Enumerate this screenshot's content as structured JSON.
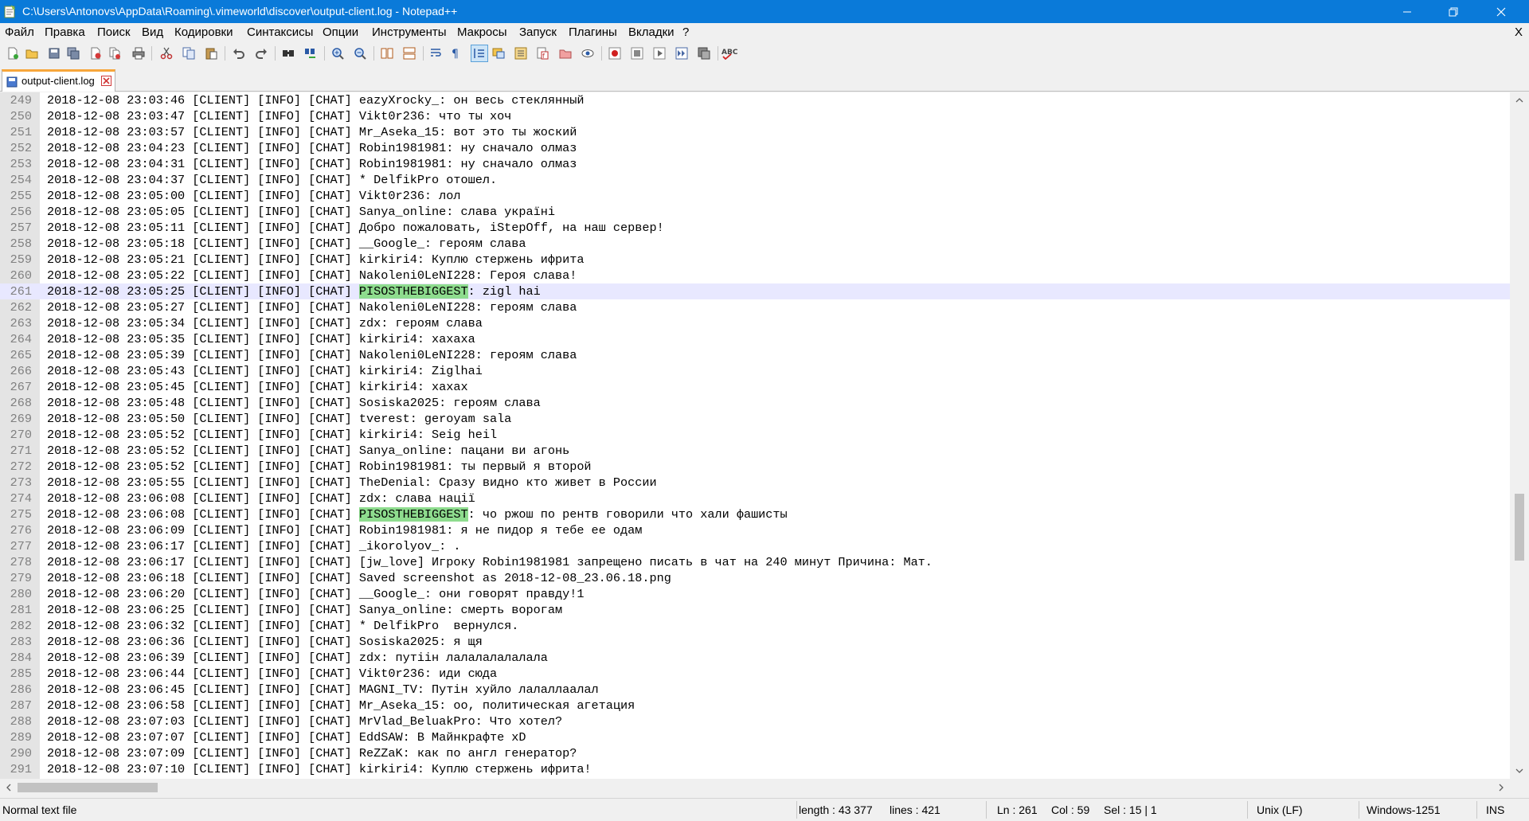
{
  "window": {
    "title": "C:\\Users\\Antonovs\\AppData\\Roaming\\.vimeworld\\discover\\output-client.log - Notepad++",
    "accent": "#0a7ad9"
  },
  "menu": [
    "Файл",
    "Правка",
    "Поиск",
    "Вид",
    "Кодировки",
    "Синтаксисы",
    "Опции",
    "Инструменты",
    "Макросы",
    "Запуск",
    "Плагины",
    "Вкладки",
    "?"
  ],
  "menu_close": "X",
  "toolbar_icons": [
    "new-file-icon",
    "open-file-icon",
    "save-icon",
    "save-all-icon",
    "close-icon",
    "close-all-icon",
    "print-icon",
    "cut-icon",
    "copy-icon",
    "paste-icon",
    "undo-icon",
    "redo-icon",
    "find-icon",
    "replace-icon",
    "zoom-in-icon",
    "zoom-out-icon",
    "sync-vertical-icon",
    "sync-horizontal-icon",
    "word-wrap-icon",
    "show-all-chars-icon",
    "indent-guide-icon",
    "document-map-icon",
    "function-list-icon",
    "folder-workspace-icon",
    "monitoring-icon",
    "record-macro-icon",
    "stop-macro-icon",
    "play-macro-icon",
    "run-macro-multiple-icon",
    "save-macro-icon",
    "spell-check-icon"
  ],
  "tab": {
    "label": "output-client.log"
  },
  "editor": {
    "current_line": 261,
    "highlight_word": "PISOSTHEBIGGEST",
    "lines": [
      {
        "n": "249",
        "t": "2018-12-08 23:03:46 [CLIENT] [INFO] [CHAT] eazyXrocky_: он весь стеклянный"
      },
      {
        "n": "250",
        "t": "2018-12-08 23:03:47 [CLIENT] [INFO] [CHAT] Vikt0r236: что ты хоч"
      },
      {
        "n": "251",
        "t": "2018-12-08 23:03:57 [CLIENT] [INFO] [CHAT] Mr_Aseka_15: вот это ты жоский"
      },
      {
        "n": "252",
        "t": "2018-12-08 23:04:23 [CLIENT] [INFO] [CHAT] Robin1981981: ну сначало олмаз"
      },
      {
        "n": "253",
        "t": "2018-12-08 23:04:31 [CLIENT] [INFO] [CHAT] Robin1981981: ну сначало олмаз"
      },
      {
        "n": "254",
        "t": "2018-12-08 23:04:37 [CLIENT] [INFO] [CHAT] * DelfikPro отошел."
      },
      {
        "n": "255",
        "t": "2018-12-08 23:05:00 [CLIENT] [INFO] [CHAT] Vikt0r236: лол"
      },
      {
        "n": "256",
        "t": "2018-12-08 23:05:05 [CLIENT] [INFO] [CHAT] Sanya_online: слава україні"
      },
      {
        "n": "257",
        "t": "2018-12-08 23:05:11 [CLIENT] [INFO] [CHAT] Добро пожаловать, iStepOff, на наш сервер!"
      },
      {
        "n": "258",
        "t": "2018-12-08 23:05:18 [CLIENT] [INFO] [CHAT] __Google_: героям слава"
      },
      {
        "n": "259",
        "t": "2018-12-08 23:05:21 [CLIENT] [INFO] [CHAT] kirkiri4: Куплю стержень ифрита"
      },
      {
        "n": "260",
        "t": "2018-12-08 23:05:22 [CLIENT] [INFO] [CHAT] Nakoleni0LeNI228: Героя слава!"
      },
      {
        "n": "261",
        "t": "2018-12-08 23:05:25 [CLIENT] [INFO] [CHAT] PISOSTHEBIGGEST: zigl hai"
      },
      {
        "n": "262",
        "t": "2018-12-08 23:05:27 [CLIENT] [INFO] [CHAT] Nakoleni0LeNI228: героям слава"
      },
      {
        "n": "263",
        "t": "2018-12-08 23:05:34 [CLIENT] [INFO] [CHAT] zdx: героям слава"
      },
      {
        "n": "264",
        "t": "2018-12-08 23:05:35 [CLIENT] [INFO] [CHAT] kirkiri4: хахаха"
      },
      {
        "n": "265",
        "t": "2018-12-08 23:05:39 [CLIENT] [INFO] [CHAT] Nakoleni0LeNI228: героям слава"
      },
      {
        "n": "266",
        "t": "2018-12-08 23:05:43 [CLIENT] [INFO] [CHAT] kirkiri4: Ziglhai"
      },
      {
        "n": "267",
        "t": "2018-12-08 23:05:45 [CLIENT] [INFO] [CHAT] kirkiri4: хахах"
      },
      {
        "n": "268",
        "t": "2018-12-08 23:05:48 [CLIENT] [INFO] [CHAT] Sosiska2025: героям слава"
      },
      {
        "n": "269",
        "t": "2018-12-08 23:05:50 [CLIENT] [INFO] [CHAT] tverest: geroyam sala"
      },
      {
        "n": "270",
        "t": "2018-12-08 23:05:52 [CLIENT] [INFO] [CHAT] kirkiri4: Seig heil"
      },
      {
        "n": "271",
        "t": "2018-12-08 23:05:52 [CLIENT] [INFO] [CHAT] Sanya_online: пацани ви агонь"
      },
      {
        "n": "272",
        "t": "2018-12-08 23:05:52 [CLIENT] [INFO] [CHAT] Robin1981981: ты первый я второй"
      },
      {
        "n": "273",
        "t": "2018-12-08 23:05:55 [CLIENT] [INFO] [CHAT] TheDenial: Сразу видно кто живет в России"
      },
      {
        "n": "274",
        "t": "2018-12-08 23:06:08 [CLIENT] [INFO] [CHAT] zdx: слава нації"
      },
      {
        "n": "275",
        "t": "2018-12-08 23:06:08 [CLIENT] [INFO] [CHAT] PISOSTHEBIGGEST: чо ржош по рентв говорили что хали фашисты"
      },
      {
        "n": "276",
        "t": "2018-12-08 23:06:09 [CLIENT] [INFO] [CHAT] Robin1981981: я не пидор я тебе ее одам"
      },
      {
        "n": "277",
        "t": "2018-12-08 23:06:17 [CLIENT] [INFO] [CHAT] _ikorolyov_: ."
      },
      {
        "n": "278",
        "t": "2018-12-08 23:06:17 [CLIENT] [INFO] [CHAT] [jw_love] Игроку Robin1981981 запрещено писать в чат на 240 минут Причина: Мат."
      },
      {
        "n": "279",
        "t": "2018-12-08 23:06:18 [CLIENT] [INFO] [CHAT] Saved screenshot as 2018-12-08_23.06.18.png"
      },
      {
        "n": "280",
        "t": "2018-12-08 23:06:20 [CLIENT] [INFO] [CHAT] __Google_: они говорят правду!1"
      },
      {
        "n": "281",
        "t": "2018-12-08 23:06:25 [CLIENT] [INFO] [CHAT] Sanya_online: смерть ворогам"
      },
      {
        "n": "282",
        "t": "2018-12-08 23:06:32 [CLIENT] [INFO] [CHAT] * DelfikPro  вернулся."
      },
      {
        "n": "283",
        "t": "2018-12-08 23:06:36 [CLIENT] [INFO] [CHAT] Sosiska2025: я щя"
      },
      {
        "n": "284",
        "t": "2018-12-08 23:06:39 [CLIENT] [INFO] [CHAT] zdx: путіін лалалалалалала"
      },
      {
        "n": "285",
        "t": "2018-12-08 23:06:44 [CLIENT] [INFO] [CHAT] Vikt0r236: иди сюда"
      },
      {
        "n": "286",
        "t": "2018-12-08 23:06:45 [CLIENT] [INFO] [CHAT] MAGNI_TV: Путін хуйло лалаллаалал"
      },
      {
        "n": "287",
        "t": "2018-12-08 23:06:58 [CLIENT] [INFO] [CHAT] Mr_Aseka_15: оо, политическая агетация"
      },
      {
        "n": "288",
        "t": "2018-12-08 23:07:03 [CLIENT] [INFO] [CHAT] MrVlad_BeluakPro: Что хотел?"
      },
      {
        "n": "289",
        "t": "2018-12-08 23:07:07 [CLIENT] [INFO] [CHAT] EddSAW: В Майнкрафте xD"
      },
      {
        "n": "290",
        "t": "2018-12-08 23:07:09 [CLIENT] [INFO] [CHAT] ReZZaK: как по англ генератор?"
      },
      {
        "n": "291",
        "t": "2018-12-08 23:07:10 [CLIENT] [INFO] [CHAT] kirkiri4: Куплю стержень ифрита!"
      }
    ]
  },
  "status": {
    "file_type": "Normal text file",
    "length": "length : 43 377",
    "lines": "lines : 421",
    "ln": "Ln : 261",
    "col": "Col : 59",
    "sel": "Sel : 15 | 1",
    "eol": "Unix (LF)",
    "encoding": "Windows-1251",
    "mode": "INS"
  }
}
